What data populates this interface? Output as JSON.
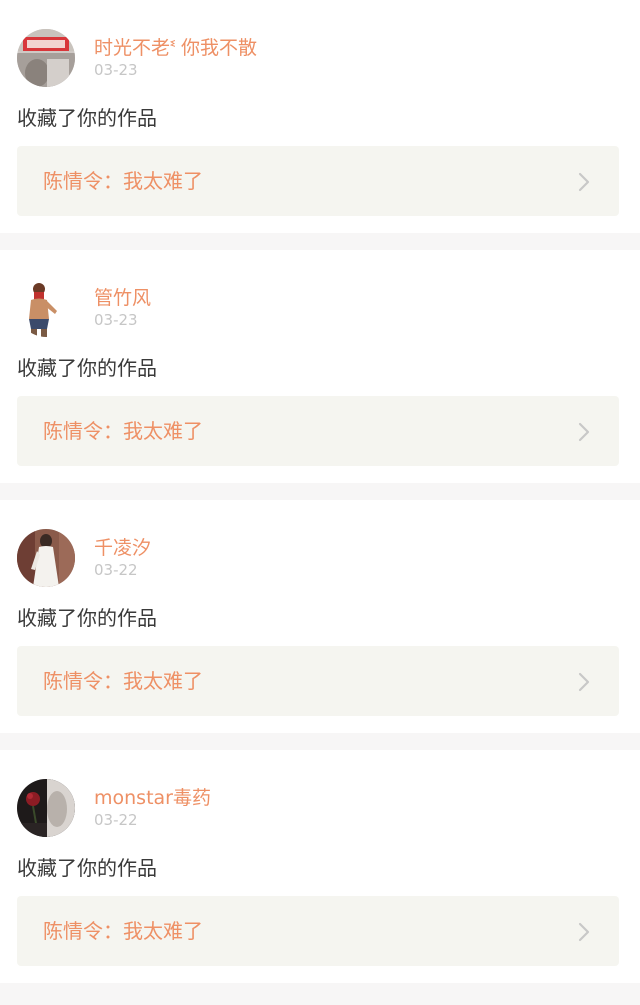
{
  "notifications": [
    {
      "username": "时光不老ᓫ 你我不散",
      "date": "03-23",
      "action": "收藏了你的作品",
      "work_title": "陈情令：我太难了",
      "avatar": "avatar-red-sign-photo"
    },
    {
      "username": "管竹风",
      "date": "03-23",
      "action": "收藏了你的作品",
      "work_title": "陈情令：我太难了",
      "avatar": "avatar-figure-illustration"
    },
    {
      "username": "千凌汐",
      "date": "03-22",
      "action": "收藏了你的作品",
      "work_title": "陈情令：我太难了",
      "avatar": "avatar-white-dress-photo"
    },
    {
      "username": "monstar毒药",
      "date": "03-22",
      "action": "收藏了你的作品",
      "work_title": "陈情令：我太难了",
      "avatar": "avatar-dark-rose-photo"
    }
  ],
  "colors": {
    "accent": "#ee9065",
    "date_gray": "#c6c6c6",
    "text_dark": "#3a3a3a",
    "card_link_bg": "#f5f5f0",
    "page_bg": "#f7f6f6"
  }
}
